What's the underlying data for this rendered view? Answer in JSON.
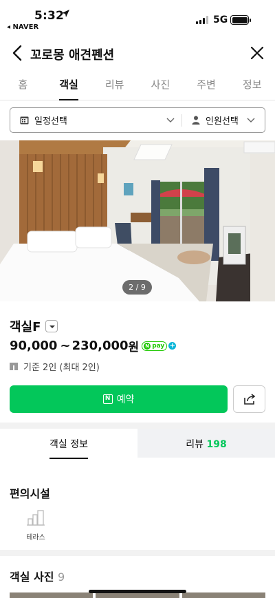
{
  "status_bar": {
    "time": "5:32",
    "back_app": "◂ NAVER",
    "network": "5G"
  },
  "header": {
    "title": "꼬로몽 애견펜션"
  },
  "tabs": [
    {
      "label": "홈",
      "active": false
    },
    {
      "label": "객실",
      "active": true
    },
    {
      "label": "리뷰",
      "active": false
    },
    {
      "label": "사진",
      "active": false
    },
    {
      "label": "주변",
      "active": false
    },
    {
      "label": "정보",
      "active": false
    }
  ],
  "selector": {
    "date_label": "일정선택",
    "people_label": "인원선택"
  },
  "photo": {
    "counter": "2 / 9"
  },
  "room": {
    "name": "객실F",
    "price_min": "90,000",
    "tilde": "~",
    "price_max": "230,000",
    "currency": "원",
    "npay": "pay",
    "capacity": "기준 2인 (최대 2인)"
  },
  "actions": {
    "reserve_label": "예약",
    "reserve_badge": "N"
  },
  "subtabs": {
    "info_label": "객실 정보",
    "review_label": "리뷰",
    "review_count": "198"
  },
  "amenities": {
    "title": "편의시설",
    "items": [
      {
        "label": "테라스",
        "icon": "building-icon"
      }
    ]
  },
  "photos_section": {
    "title": "객실 사진",
    "count": "9"
  },
  "colors": {
    "brand_green": "#03c75a",
    "npay_green": "#1ec800",
    "npay_plus": "#09b4d8"
  }
}
